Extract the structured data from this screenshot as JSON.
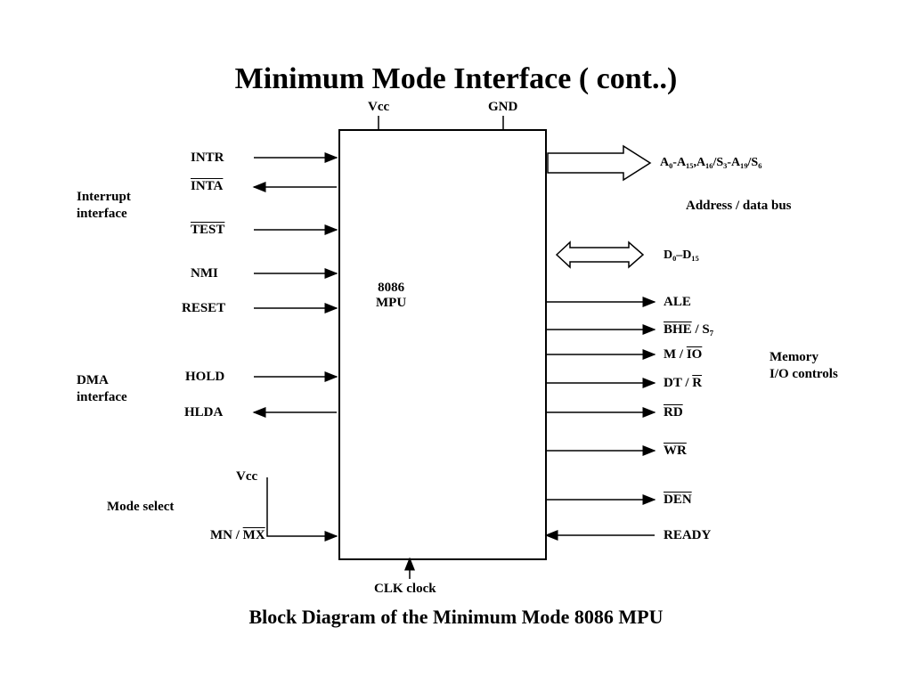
{
  "title": "Minimum Mode Interface  ( cont..)",
  "caption": "Block Diagram of the Minimum Mode 8086 MPU",
  "mpu": {
    "line1": "8086",
    "line2": "MPU"
  },
  "top": {
    "vcc": "Vcc",
    "gnd": "GND"
  },
  "left_pins": {
    "intr": "INTR",
    "inta": "INTA",
    "test": "TEST",
    "nmi": "NMI",
    "reset": "RESET",
    "hold": "HOLD",
    "hlda": "HLDA"
  },
  "mode_select": {
    "vcc": "Vcc",
    "mn_mx": "MN / ",
    "mx": "MX",
    "label": "Mode select"
  },
  "right_pins": {
    "addr": "A₀-A₁₅,A₁₆/S₃-A₁₉/S₆",
    "addr_bus": "Address / data bus",
    "data": "D₀–D₁₅",
    "ale": "ALE",
    "bhe": "BHE",
    "s7": " / S₇",
    "m": "M / ",
    "io": "IO",
    "dt": "DT / ",
    "r": "R",
    "rd": "RD",
    "wr": "WR",
    "den": "DEN",
    "ready": "READY"
  },
  "groups": {
    "interrupt": "Interrupt interface",
    "dma": "DMA interface",
    "mem_io": "Memory I/O controls"
  },
  "clk": "CLK clock"
}
